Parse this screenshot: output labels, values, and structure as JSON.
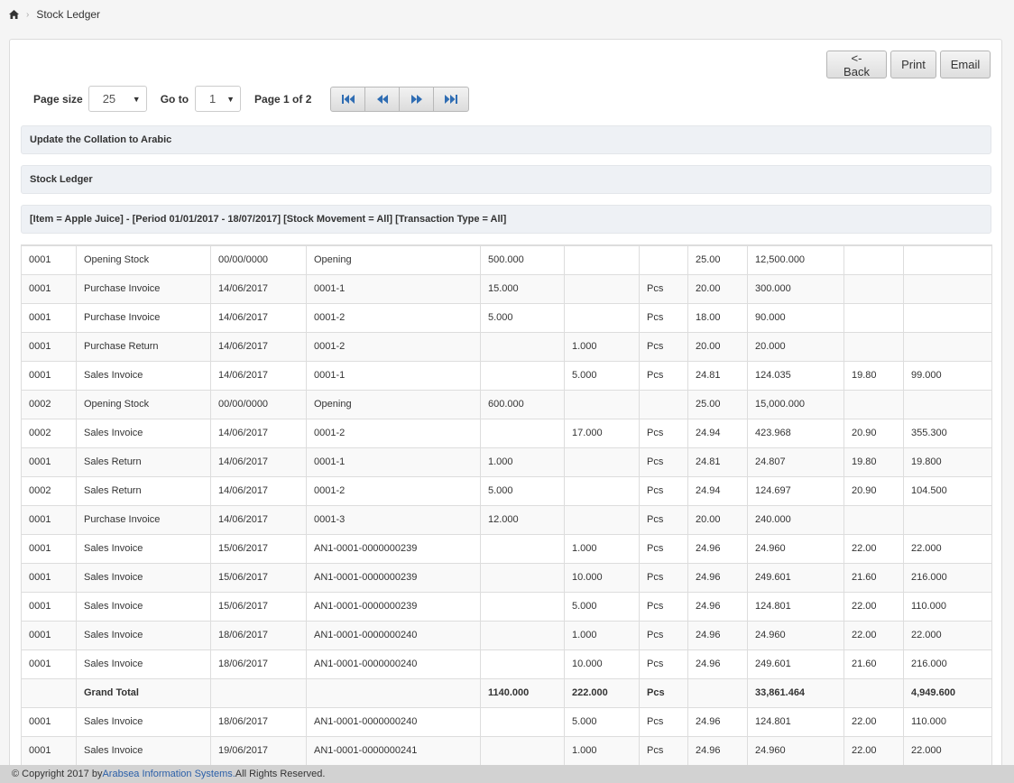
{
  "breadcrumb": {
    "current": "Stock Ledger"
  },
  "toolbar": {
    "back_label": "<- Back",
    "print_label": "Print",
    "email_label": "Email"
  },
  "pager": {
    "page_size_label": "Page size",
    "page_size_value": "25",
    "goto_label": "Go to",
    "goto_value": "1",
    "page_info": "Page 1 of 2"
  },
  "bars": {
    "collation": "Update the Collation to Arabic",
    "report_title": "Stock Ledger",
    "filter": "[Item = Apple Juice] - [Period 01/01/2017 - 18/07/2017] [Stock Movement = All] [Transaction Type = All]"
  },
  "rows": [
    {
      "c0": "0001",
      "c1": "Opening Stock",
      "c2": "00/00/0000",
      "c3": "Opening",
      "c4": "500.000",
      "c5": "",
      "c6": "",
      "c7": "25.00",
      "c8": "12,500.000",
      "c9": "",
      "c10": ""
    },
    {
      "c0": "0001",
      "c1": "Purchase Invoice",
      "c2": "14/06/2017",
      "c3": "0001-1",
      "c4": "15.000",
      "c5": "",
      "c6": "Pcs",
      "c7": "20.00",
      "c8": "300.000",
      "c9": "",
      "c10": ""
    },
    {
      "c0": "0001",
      "c1": "Purchase Invoice",
      "c2": "14/06/2017",
      "c3": "0001-2",
      "c4": "5.000",
      "c5": "",
      "c6": "Pcs",
      "c7": "18.00",
      "c8": "90.000",
      "c9": "",
      "c10": ""
    },
    {
      "c0": "0001",
      "c1": "Purchase Return",
      "c2": "14/06/2017",
      "c3": "0001-2",
      "c4": "",
      "c5": "1.000",
      "c6": "Pcs",
      "c7": "20.00",
      "c8": "20.000",
      "c9": "",
      "c10": ""
    },
    {
      "c0": "0001",
      "c1": "Sales Invoice",
      "c2": "14/06/2017",
      "c3": "0001-1",
      "c4": "",
      "c5": "5.000",
      "c6": "Pcs",
      "c7": "24.81",
      "c8": "124.035",
      "c9": "19.80",
      "c10": "99.000"
    },
    {
      "c0": "0002",
      "c1": "Opening Stock",
      "c2": "00/00/0000",
      "c3": "Opening",
      "c4": "600.000",
      "c5": "",
      "c6": "",
      "c7": "25.00",
      "c8": "15,000.000",
      "c9": "",
      "c10": ""
    },
    {
      "c0": "0002",
      "c1": "Sales Invoice",
      "c2": "14/06/2017",
      "c3": "0001-2",
      "c4": "",
      "c5": "17.000",
      "c6": "Pcs",
      "c7": "24.94",
      "c8": "423.968",
      "c9": "20.90",
      "c10": "355.300"
    },
    {
      "c0": "0001",
      "c1": "Sales Return",
      "c2": "14/06/2017",
      "c3": "0001-1",
      "c4": "1.000",
      "c5": "",
      "c6": "Pcs",
      "c7": "24.81",
      "c8": "24.807",
      "c9": "19.80",
      "c10": "19.800"
    },
    {
      "c0": "0002",
      "c1": "Sales Return",
      "c2": "14/06/2017",
      "c3": "0001-2",
      "c4": "5.000",
      "c5": "",
      "c6": "Pcs",
      "c7": "24.94",
      "c8": "124.697",
      "c9": "20.90",
      "c10": "104.500"
    },
    {
      "c0": "0001",
      "c1": "Purchase Invoice",
      "c2": "14/06/2017",
      "c3": "0001-3",
      "c4": "12.000",
      "c5": "",
      "c6": "Pcs",
      "c7": "20.00",
      "c8": "240.000",
      "c9": "",
      "c10": ""
    },
    {
      "c0": "0001",
      "c1": "Sales Invoice",
      "c2": "15/06/2017",
      "c3": "AN1-0001-0000000239",
      "c4": "",
      "c5": "1.000",
      "c6": "Pcs",
      "c7": "24.96",
      "c8": "24.960",
      "c9": "22.00",
      "c10": "22.000"
    },
    {
      "c0": "0001",
      "c1": "Sales Invoice",
      "c2": "15/06/2017",
      "c3": "AN1-0001-0000000239",
      "c4": "",
      "c5": "10.000",
      "c6": "Pcs",
      "c7": "24.96",
      "c8": "249.601",
      "c9": "21.60",
      "c10": "216.000"
    },
    {
      "c0": "0001",
      "c1": "Sales Invoice",
      "c2": "15/06/2017",
      "c3": "AN1-0001-0000000239",
      "c4": "",
      "c5": "5.000",
      "c6": "Pcs",
      "c7": "24.96",
      "c8": "124.801",
      "c9": "22.00",
      "c10": "110.000"
    },
    {
      "c0": "0001",
      "c1": "Sales Invoice",
      "c2": "18/06/2017",
      "c3": "AN1-0001-0000000240",
      "c4": "",
      "c5": "1.000",
      "c6": "Pcs",
      "c7": "24.96",
      "c8": "24.960",
      "c9": "22.00",
      "c10": "22.000"
    },
    {
      "c0": "0001",
      "c1": "Sales Invoice",
      "c2": "18/06/2017",
      "c3": "AN1-0001-0000000240",
      "c4": "",
      "c5": "10.000",
      "c6": "Pcs",
      "c7": "24.96",
      "c8": "249.601",
      "c9": "21.60",
      "c10": "216.000"
    },
    {
      "c0": "",
      "c1": "Grand Total",
      "c2": "",
      "c3": "",
      "c4": "1140.000",
      "c5": "222.000",
      "c6": "Pcs",
      "c7": "",
      "c8": "33,861.464",
      "c9": "",
      "c10": "4,949.600",
      "total": true
    },
    {
      "c0": "0001",
      "c1": "Sales Invoice",
      "c2": "18/06/2017",
      "c3": "AN1-0001-0000000240",
      "c4": "",
      "c5": "5.000",
      "c6": "Pcs",
      "c7": "24.96",
      "c8": "124.801",
      "c9": "22.00",
      "c10": "110.000"
    },
    {
      "c0": "0001",
      "c1": "Sales Invoice",
      "c2": "19/06/2017",
      "c3": "AN1-0001-0000000241",
      "c4": "",
      "c5": "1.000",
      "c6": "Pcs",
      "c7": "24.96",
      "c8": "24.960",
      "c9": "22.00",
      "c10": "22.000"
    }
  ],
  "footer": {
    "prefix": "© Copyright 2017 by ",
    "company": "Arabsea Information Systems.",
    "suffix": " All Rights Reserved."
  }
}
